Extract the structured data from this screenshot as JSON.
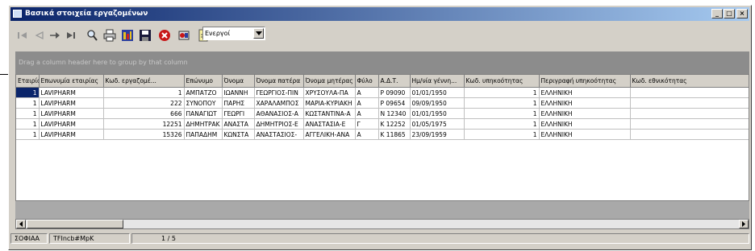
{
  "window": {
    "title": "Βασικά στοιχεία εργαζομένων",
    "controls": {
      "minimize": "_",
      "maximize": "□",
      "close": "×"
    }
  },
  "toolbar": {
    "icons": [
      "first-icon",
      "prev-icon",
      "next-icon",
      "last-icon",
      "find-icon",
      "print-icon",
      "report-icon",
      "save-icon",
      "delete-icon",
      "tools-icon",
      "new-document-icon"
    ],
    "status_filter": {
      "value": "Ενεργοί"
    }
  },
  "group_panel": {
    "hint": "Drag a column header here to group by that column"
  },
  "grid": {
    "columns": [
      "Εταιρία",
      "Επωνυμία εταιρίας",
      "Κωδ. εργαζομέ...",
      "Επώνυμο",
      "Όνομα",
      "Όνομα πατέρα",
      "Όνομα μητέρας",
      "Φύλο",
      "Α.Δ.Τ.",
      "Ημ/νία γέννη...",
      "Κωδ. υπηκοότητας",
      "Περιγραφή υπηκοότητας",
      "Κωδ. εθνικότητας"
    ],
    "rows": [
      [
        "1",
        "LAVIPHARM",
        "1",
        "ΑΜΠΑΤΖΟ",
        "ΙΩΑΝΝΗ",
        "ΓΕΩΡΓΙΟΣ-ΠΙΝ",
        "ΧΡΥΣΟΥΛΑ-ΠΑ",
        "Α",
        "Ρ 09090",
        "01/01/1950",
        "1",
        "ΕΛΛΗΝΙΚΗ",
        "1"
      ],
      [
        "1",
        "LAVIPHARM",
        "222",
        "ΣΥΝΟΠΟΥ",
        "ΠΑΡΗΣ",
        "ΧΑΡΑΛΑΜΠΟΣ",
        "ΜΑΡΙΑ-ΚΥΡΙΑΚΗ",
        "Α",
        "Ρ 09654",
        "09/09/1950",
        "1",
        "ΕΛΛΗΝΙΚΗ",
        "1"
      ],
      [
        "1",
        "LAVIPHARM",
        "666",
        "ΠΑΝΑΓΙΩΤ",
        "ΓΕΩΡΓΙ",
        "ΑΘΑΝΑΣΙΟΣ-Α",
        "ΚΩΣΤΑΝΤΙΝΑ-Α",
        "Α",
        "Ν 12340",
        "01/01/1950",
        "1",
        "ΕΛΛΗΝΙΚΗ",
        "1"
      ],
      [
        "1",
        "LAVIPHARM",
        "12251",
        "ΔΗΜΗΤΡΑΚ",
        "ΑΝΑΣΤΑ",
        "ΔΗΜΗΤΡΙΟΣ-Ε",
        "ΑΝΑΣΤΑΣΙΑ-Ε",
        "Γ",
        "Κ 12252",
        "01/05/1975",
        "1",
        "ΕΛΛΗΝΙΚΗ",
        "1"
      ],
      [
        "1",
        "LAVIPHARM",
        "15326",
        "ΠΑΠΑΔΗΜ",
        "ΚΩΝΣΤΑ",
        "ΑΝΑΣΤΑΣΙΟΣ-",
        "ΑΓΓΕΛΙΚΗ-ΑΝΑ",
        "Α",
        "Κ 11865",
        "23/09/1959",
        "1",
        "ΕΛΛΗΝΙΚΗ",
        "1"
      ]
    ]
  },
  "statusbar": {
    "panels": [
      "ΣΟΦΙΑΑ",
      "TFIncb#MpK",
      "1 / 5"
    ]
  },
  "colors": {
    "title_start": "#0a246a",
    "title_end": "#a6caf0",
    "chrome": "#d4d0c8",
    "group_panel": "#8c8c8c",
    "selection": "#0a246a"
  }
}
